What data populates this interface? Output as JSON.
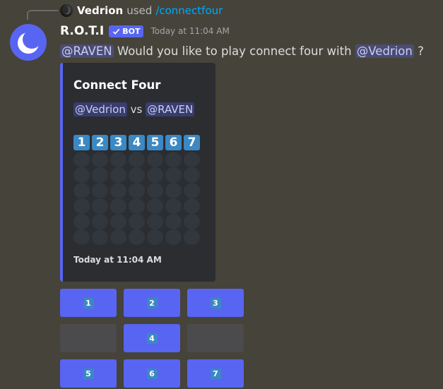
{
  "reply": {
    "username": "Vedrion",
    "used_text": "used",
    "command": "/connectfour"
  },
  "message": {
    "author": "R.O.T.I",
    "bot_tag": "BOT",
    "timestamp": "Today at 11:04 AM",
    "mention_challenged": "@RAVEN",
    "text_middle": "Would you like to play connect four with",
    "mention_challenger": "@Vedrion",
    "text_end": "?"
  },
  "embed": {
    "title": "Connect Four",
    "player1": "@Vedrion",
    "vs": "vs",
    "player2": "@RAVEN",
    "column_numbers": [
      "1",
      "2",
      "3",
      "4",
      "5",
      "6",
      "7"
    ],
    "rows": 6,
    "columns": 7,
    "footer_timestamp": "Today at 11:04 AM"
  },
  "buttons": [
    {
      "label": "1",
      "disabled": false
    },
    {
      "label": "2",
      "disabled": false
    },
    {
      "label": "3",
      "disabled": false
    },
    {
      "label": "",
      "disabled": true
    },
    {
      "label": "4",
      "disabled": false
    },
    {
      "label": "",
      "disabled": true
    },
    {
      "label": "5",
      "disabled": false
    },
    {
      "label": "6",
      "disabled": false
    },
    {
      "label": "7",
      "disabled": false
    }
  ],
  "colors": {
    "background": "#46433a",
    "blurple": "#5865f2",
    "embed_bg": "#2b2d31",
    "number_tile": "#3b88c3",
    "empty_cell": "#31373d",
    "command_link": "#00a8fc"
  },
  "icons": {
    "bot_avatar": "crescent-moon-icon",
    "bot_verified": "checkmark-icon"
  }
}
